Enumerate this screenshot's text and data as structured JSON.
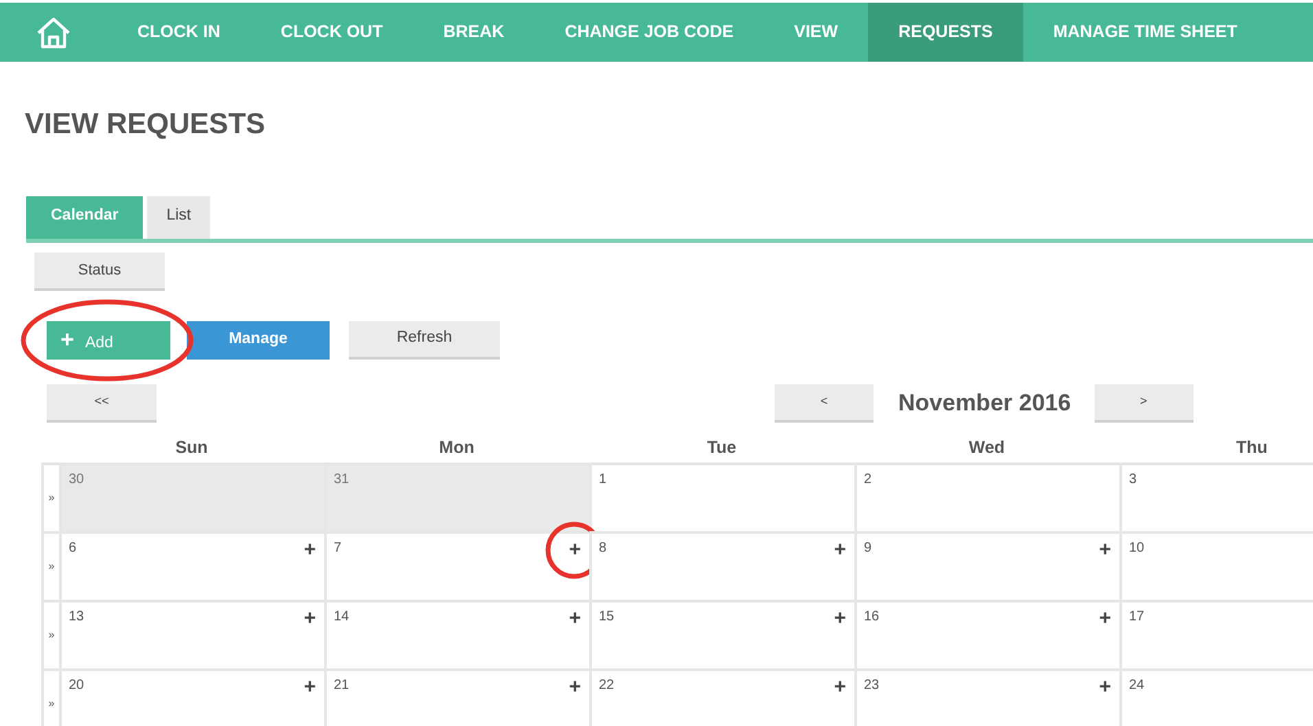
{
  "nav": [
    {
      "kind": "home",
      "selected": false
    },
    {
      "label": "CLOCK IN",
      "selected": false
    },
    {
      "label": "CLOCK OUT",
      "selected": false
    },
    {
      "label": "BREAK",
      "selected": false
    },
    {
      "label": "CHANGE JOB CODE",
      "selected": false
    },
    {
      "label": "VIEW",
      "selected": false
    },
    {
      "label": "REQUESTS",
      "selected": true
    },
    {
      "label": "MANAGE TIME SHEET",
      "selected": false
    }
  ],
  "page_title": "VIEW REQUESTS",
  "tabs": [
    {
      "label": "Calendar",
      "selected": true
    },
    {
      "label": "List",
      "selected": false
    }
  ],
  "status_button": "Status",
  "actions": [
    {
      "kind": "add",
      "label": "Add",
      "icon": "+",
      "highlighted": true
    },
    {
      "kind": "manage",
      "label": "Manage",
      "highlighted": false
    },
    {
      "kind": "refresh",
      "label": "Refresh",
      "highlighted": false
    }
  ],
  "calendar": {
    "back_button": "<<",
    "prev_button": "<",
    "month": "November 2016",
    "next_button": ">",
    "weekdays": [
      "Sun",
      "Mon",
      "Tue",
      "Wed",
      "Thu"
    ],
    "weeks": [
      {
        "marker": "»",
        "days": [
          {
            "day": "30",
            "other_month": true,
            "add": false,
            "highlighted": false
          },
          {
            "day": "31",
            "other_month": true,
            "add": false,
            "highlighted": false
          },
          {
            "day": "1",
            "other_month": false,
            "add": false,
            "highlighted": false
          },
          {
            "day": "2",
            "other_month": false,
            "add": false,
            "highlighted": false
          },
          {
            "day": "3",
            "other_month": false,
            "add": false,
            "highlighted": false
          }
        ]
      },
      {
        "marker": "»",
        "days": [
          {
            "day": "6",
            "other_month": false,
            "add": true,
            "highlighted": false
          },
          {
            "day": "7",
            "other_month": false,
            "add": true,
            "highlighted": true
          },
          {
            "day": "8",
            "other_month": false,
            "add": true,
            "highlighted": false
          },
          {
            "day": "9",
            "other_month": false,
            "add": true,
            "highlighted": false
          },
          {
            "day": "10",
            "other_month": false,
            "add": false,
            "highlighted": false
          }
        ]
      },
      {
        "marker": "»",
        "days": [
          {
            "day": "13",
            "other_month": false,
            "add": true,
            "highlighted": false
          },
          {
            "day": "14",
            "other_month": false,
            "add": true,
            "highlighted": false
          },
          {
            "day": "15",
            "other_month": false,
            "add": true,
            "highlighted": false
          },
          {
            "day": "16",
            "other_month": false,
            "add": true,
            "highlighted": false
          },
          {
            "day": "17",
            "other_month": false,
            "add": false,
            "highlighted": false
          }
        ]
      },
      {
        "marker": "»",
        "days": [
          {
            "day": "20",
            "other_month": false,
            "add": true,
            "highlighted": false
          },
          {
            "day": "21",
            "other_month": false,
            "add": true,
            "highlighted": false
          },
          {
            "day": "22",
            "other_month": false,
            "add": true,
            "highlighted": false
          },
          {
            "day": "23",
            "other_month": false,
            "add": true,
            "highlighted": false
          },
          {
            "day": "24",
            "other_month": false,
            "add": false,
            "highlighted": false
          }
        ]
      }
    ]
  }
}
